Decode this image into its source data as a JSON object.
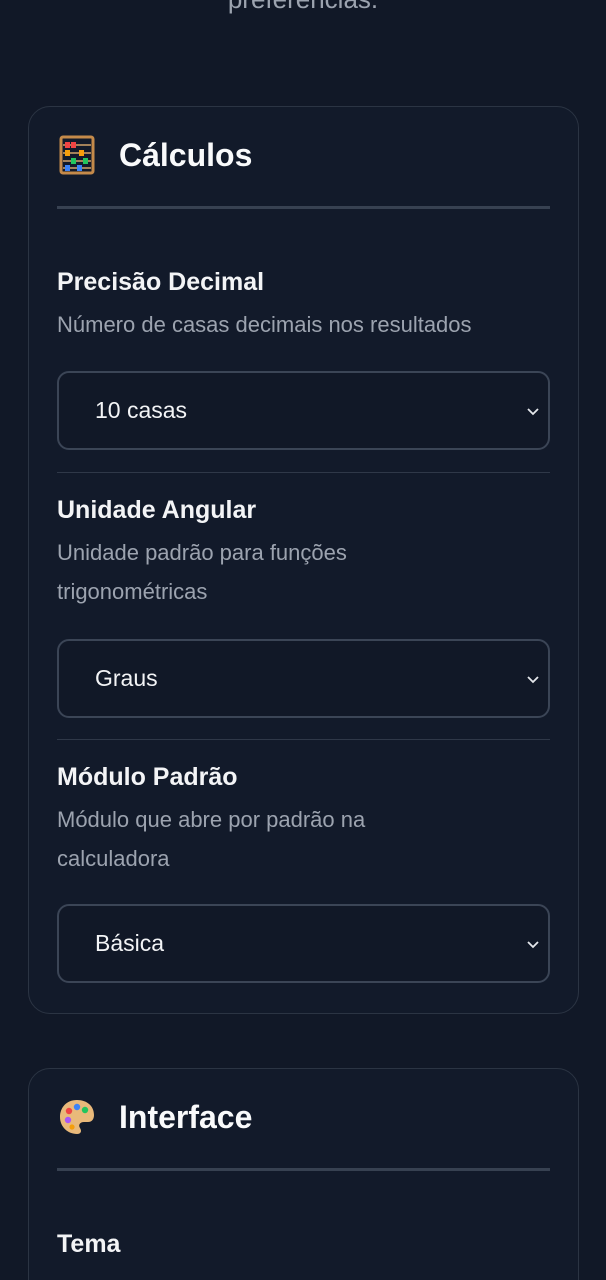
{
  "header_text": "preferências.",
  "calc_section": {
    "icon": "abacus-icon",
    "title": "Cálculos",
    "settings": [
      {
        "label": "Precisão Decimal",
        "description": "Número de casas decimais nos resultados",
        "value": "10 casas"
      },
      {
        "label": "Unidade Angular",
        "description": "Unidade padrão para funções trigonométricas",
        "value": "Graus"
      },
      {
        "label": "Módulo Padrão",
        "description": "Módulo que abre por padrão na calculadora",
        "value": "Básica"
      }
    ]
  },
  "ui_section": {
    "icon": "palette-icon",
    "title": "Interface",
    "settings": [
      {
        "label": "Tema"
      }
    ]
  },
  "colors": {
    "background": "#111827",
    "card": "#121a2a",
    "border": "#374151",
    "text": "#f3f4f6",
    "muted": "#9ca3af"
  }
}
